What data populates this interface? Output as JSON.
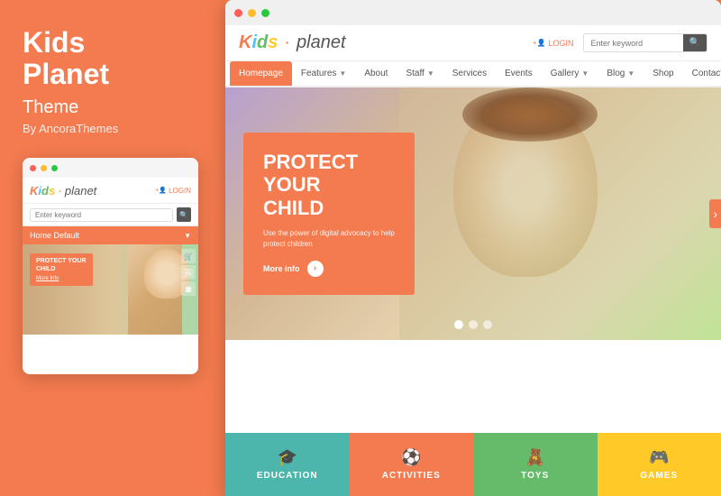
{
  "left": {
    "title": "Kids\nPlanet",
    "subtitle": "Theme",
    "byline": "By AncoraThemes"
  },
  "mobile": {
    "logo": {
      "kids_letters": [
        "K",
        "i",
        "d",
        "s"
      ],
      "separator": "·",
      "planet": "planet"
    },
    "login": "LOGIN",
    "search_placeholder": "Enter keyword",
    "nav_label": "Home Default",
    "hero_title": "PROTECT YOUR CHILD",
    "more_info": "More Info"
  },
  "browser": {
    "logo": {
      "kids_letters": [
        "K",
        "i",
        "d",
        "s"
      ],
      "separator": "·",
      "planet": "planet"
    },
    "login": "LOGIN",
    "search_placeholder": "Enter keyword",
    "nav_items": [
      {
        "label": "Homepage",
        "active": true,
        "has_arrow": false
      },
      {
        "label": "Features",
        "active": false,
        "has_arrow": true
      },
      {
        "label": "About",
        "active": false,
        "has_arrow": false
      },
      {
        "label": "Staff",
        "active": false,
        "has_arrow": true
      },
      {
        "label": "Services",
        "active": false,
        "has_arrow": false
      },
      {
        "label": "Events",
        "active": false,
        "has_arrow": false
      },
      {
        "label": "Gallery",
        "active": false,
        "has_arrow": true
      },
      {
        "label": "Blog",
        "active": false,
        "has_arrow": true
      },
      {
        "label": "Shop",
        "active": false,
        "has_arrow": false
      },
      {
        "label": "Contacts",
        "active": false,
        "has_arrow": false
      }
    ],
    "hero": {
      "title": "PROTECT YOUR\nCHILD",
      "description": "Use the power of digital advocacy to help protect children",
      "more_info": "More info"
    },
    "categories": [
      {
        "label": "EDUCATION",
        "color": "#4DB6AC"
      },
      {
        "label": "ACTIVITIES",
        "color": "#F47B4F"
      },
      {
        "label": "TOYS",
        "color": "#66BB6A"
      },
      {
        "label": "GAMES",
        "color": "#FFCA28"
      }
    ]
  }
}
